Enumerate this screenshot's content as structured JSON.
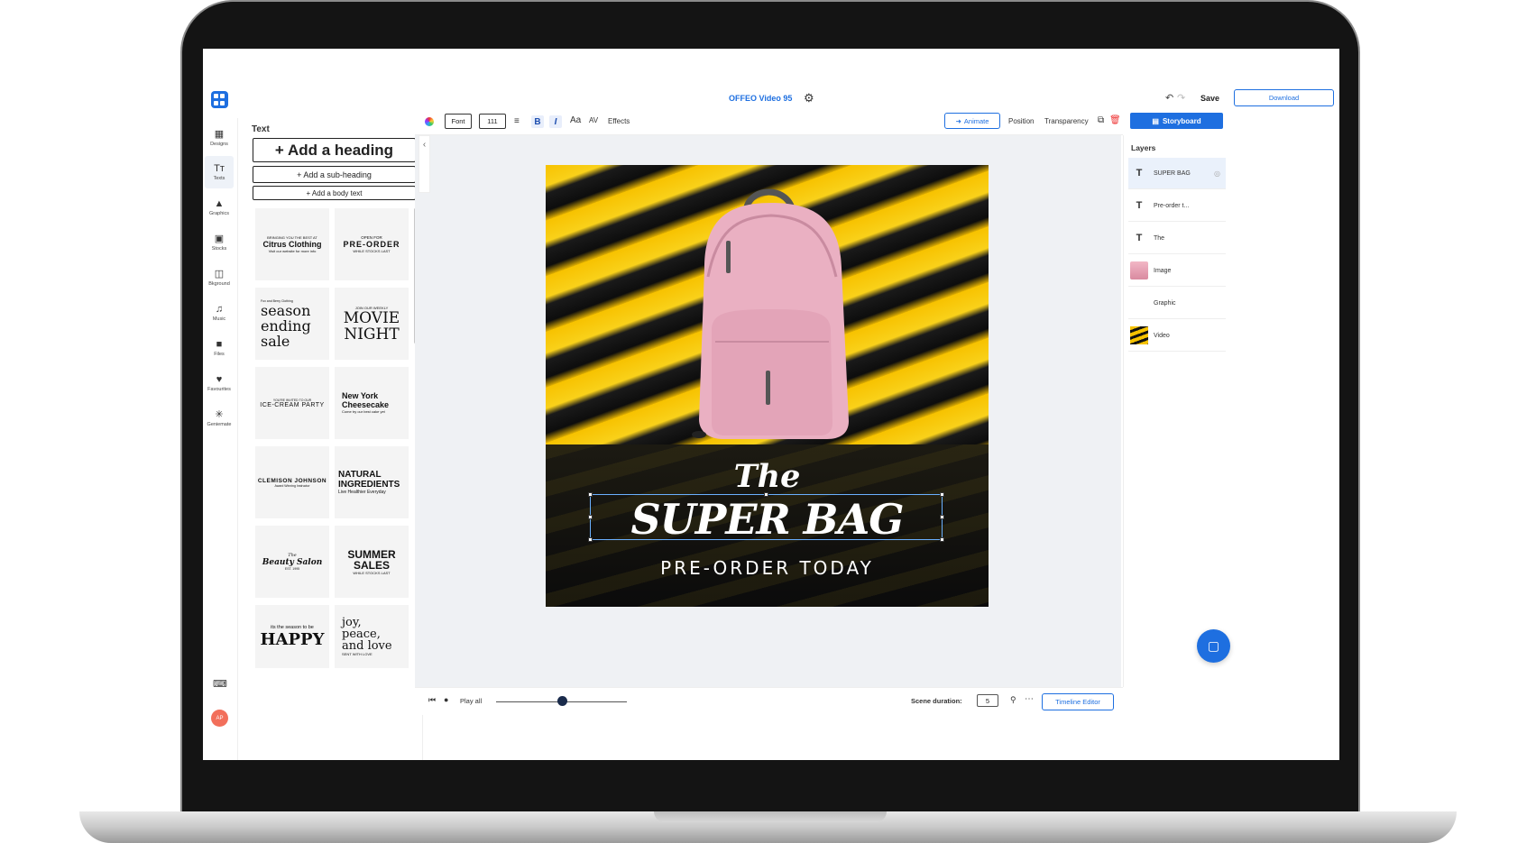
{
  "header": {
    "title": "OFFEO Video 95",
    "save_label": "Save",
    "download_label": "Download"
  },
  "rail": {
    "items": [
      {
        "label": "Designs",
        "icon": "layout-icon"
      },
      {
        "label": "Texts",
        "icon": "text-icon"
      },
      {
        "label": "Graphics",
        "icon": "shapes-icon"
      },
      {
        "label": "Stocks",
        "icon": "image-icon"
      },
      {
        "label": "Bkground",
        "icon": "background-icon"
      },
      {
        "label": "Music",
        "icon": "music-icon"
      },
      {
        "label": "Files",
        "icon": "folder-icon"
      },
      {
        "label": "Favourites",
        "icon": "heart-icon"
      },
      {
        "label": "Geniemate",
        "icon": "sparkle-icon"
      }
    ],
    "avatar_initials": "AP"
  },
  "text_panel": {
    "title": "Text",
    "add_heading": "+ Add a heading",
    "add_subheading": "+ Add a sub-heading",
    "add_body": "+ Add a body text",
    "templates": [
      {
        "lines": [
          "BRINGING YOU THE BEST AT",
          "Citrus Clothing",
          "Visit our website for more info"
        ]
      },
      {
        "lines": [
          "OPEN FOR",
          "PRE-ORDER",
          "WHILE STOCKS LAST"
        ]
      },
      {
        "lines": [
          "Fox and Berry Clothing",
          "season",
          "ending",
          "sale"
        ]
      },
      {
        "lines": [
          "JOIN OUR WEEKLY",
          "MOVIE",
          "NIGHT"
        ]
      },
      {
        "lines": [
          "YOU'RE INVITED TO OUR",
          "ICE-CREAM PARTY"
        ]
      },
      {
        "lines": [
          "New York",
          "Cheesecake",
          "Come try our best cake yet"
        ]
      },
      {
        "lines": [
          "CLEMISON JOHNSON",
          "Award Winning Instructor"
        ]
      },
      {
        "lines": [
          "NATURAL",
          "INGREDIENTS",
          "Live Healthier Everyday"
        ]
      },
      {
        "lines": [
          "The",
          "Beauty Salon",
          "EST. 1995"
        ]
      },
      {
        "lines": [
          "SUMMER",
          "SALES",
          "WHILE STOCKS LAST"
        ]
      },
      {
        "lines": [
          "its the season to be",
          "HAPPY"
        ]
      },
      {
        "lines": [
          "joy,",
          "peace,",
          "and love",
          "SENT WITH LOVE"
        ]
      }
    ]
  },
  "toolbar": {
    "font_label": "Font",
    "font_size": "111",
    "bold_label": "B",
    "italic_label": "I",
    "case_label": "Aa",
    "spacing_label": "AV",
    "effects_label": "Effects",
    "animate_label": "Animate",
    "position_label": "Position",
    "transparency_label": "Transparency",
    "storyboard_label": "Storyboard"
  },
  "canvas": {
    "line1": "The",
    "line2": "SUPER BAG",
    "line3": "PRE-ORDER TODAY"
  },
  "layers": {
    "title": "Layers",
    "items": [
      {
        "label": "SUPER BAG",
        "kind": "text"
      },
      {
        "label": "Pre-order  t...",
        "kind": "text"
      },
      {
        "label": "The",
        "kind": "text"
      },
      {
        "label": "Image",
        "kind": "image"
      },
      {
        "label": "Graphic",
        "kind": "graphic"
      },
      {
        "label": "Video",
        "kind": "video"
      }
    ]
  },
  "playback": {
    "play_all_label": "Play all",
    "scene_duration_label": "Scene duration:",
    "scene_duration_value": "5",
    "timeline_label": "Timeline Editor",
    "slider_position": 0.5
  },
  "colors": {
    "accent": "#1e6fe0",
    "canvas_yellow": "#f7c200",
    "backpack_pink": "#eab0c2"
  }
}
